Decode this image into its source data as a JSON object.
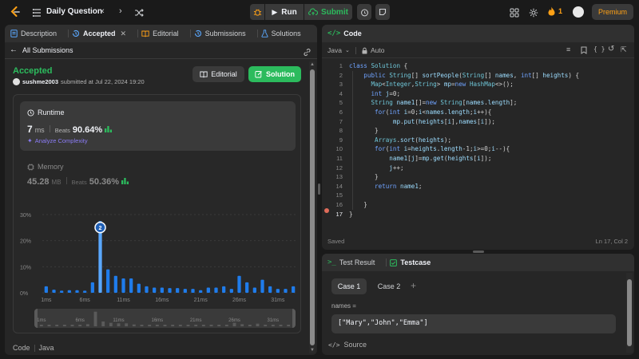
{
  "topbar": {
    "title": "Daily Question",
    "run_label": "Run",
    "submit_label": "Submit",
    "streak_count": "1",
    "premium_label": "Premium"
  },
  "left": {
    "tabs": [
      {
        "label": "Description"
      },
      {
        "label": "Accepted"
      },
      {
        "label": "Editorial"
      },
      {
        "label": "Submissions"
      },
      {
        "label": "Solutions"
      }
    ],
    "back_label": "All Submissions",
    "status": "Accepted",
    "user": "sushme2003",
    "submitted_text": "submitted at Jul 22, 2024 19:20",
    "editorial_btn": "Editorial",
    "solution_btn": "Solution",
    "runtime": {
      "title": "Runtime",
      "value": "7",
      "unit": "ms",
      "beats_label": "Beats",
      "beats": "90.64%",
      "analyze": "Analyze Complexity"
    },
    "memory": {
      "title": "Memory",
      "value": "45.28",
      "unit": "MB",
      "beats_label": "Beats",
      "beats": "50.36%"
    },
    "footer": {
      "code_label": "Code",
      "lang": "Java"
    }
  },
  "chart_data": {
    "type": "bar",
    "ylabels": [
      "30%",
      "20%",
      "10%",
      "0%"
    ],
    "ylim": [
      0,
      30
    ],
    "xlabels": [
      "1ms",
      "6ms",
      "11ms",
      "16ms",
      "21ms",
      "26ms",
      "31ms"
    ],
    "values": [
      2.5,
      1.2,
      0.8,
      1.0,
      1.0,
      0.8,
      4.0,
      27.5,
      9.0,
      6.5,
      5.5,
      5.5,
      3.5,
      2.5,
      2.0,
      2.0,
      1.8,
      1.8,
      1.5,
      1.5,
      1.0,
      2.0,
      2.0,
      2.5,
      1.5,
      6.5,
      4.0,
      2.0,
      5.0,
      2.5,
      1.5,
      1.5,
      2.5
    ],
    "highlight_index": 7,
    "highlight_badge": "2",
    "mini_labels": [
      "1ms",
      "6ms",
      "11ms",
      "16ms",
      "21ms",
      "26ms",
      "31ms"
    ],
    "colors": {
      "bar": "#1f7ceb",
      "highlight": "#5aa8ff"
    }
  },
  "code_panel": {
    "title": "Code",
    "lang": "Java",
    "mode": "Auto",
    "lines": [
      "class Solution {",
      "    public String[] sortPeople(String[] names, int[] heights) {",
      "      Map<Integer,String> mp=new HashMap<>();",
      "      int j=0;",
      "      String name1[]=new String[names.length];",
      "       for(int i=0;i<names.length;i++){",
      "            mp.put(heights[i],names[i]);",
      "       }",
      "       Arrays.sort(heights);",
      "       for(int i=heights.length-1;i>=0;i--){",
      "           name1[j]=mp.get(heights[i]);",
      "           j++;",
      "       }",
      "       return name1;",
      "",
      "    }",
      "}"
    ],
    "status": "Saved",
    "cursor": "Ln 17, Col 2"
  },
  "bottom": {
    "tab_result": "Test Result",
    "tab_testcase": "Testcase",
    "case1": "Case 1",
    "case2": "Case 2",
    "var_label": "names =",
    "var_value": "[\"Mary\",\"John\",\"Emma\"]",
    "source_label": "Source"
  },
  "colors": {
    "accent_green": "#2cbb5d",
    "accepted": "#2cbb5d",
    "orange": "#ffa116"
  }
}
